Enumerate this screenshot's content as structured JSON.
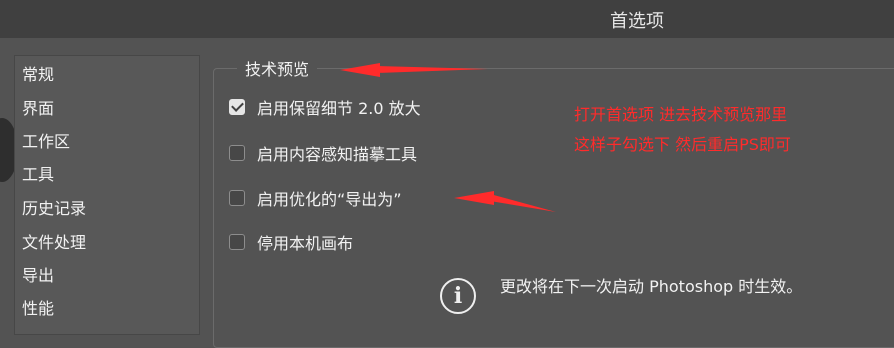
{
  "dialog": {
    "title": "首选项"
  },
  "sidebar": {
    "items": [
      {
        "label": "常规"
      },
      {
        "label": "界面"
      },
      {
        "label": "工作区"
      },
      {
        "label": "工具"
      },
      {
        "label": "历史记录"
      },
      {
        "label": "文件处理"
      },
      {
        "label": "导出"
      },
      {
        "label": "性能"
      }
    ]
  },
  "section": {
    "title": "技术预览",
    "options": [
      {
        "label": "启用保留细节 2.0 放大",
        "checked": true
      },
      {
        "label": "启用内容感知描摹工具",
        "checked": false
      },
      {
        "label": "启用优化的“导出为”",
        "checked": false
      },
      {
        "label": "停用本机画布",
        "checked": false
      }
    ]
  },
  "annotation": {
    "line1": "打开首选项  进去技术预览那里",
    "line2": "这样子勾选下 然后重启PS即可",
    "color": "#ff2b2b"
  },
  "info": {
    "icon": "info-icon",
    "text": "更改将在下一次启动 Photoshop 时生效。"
  }
}
